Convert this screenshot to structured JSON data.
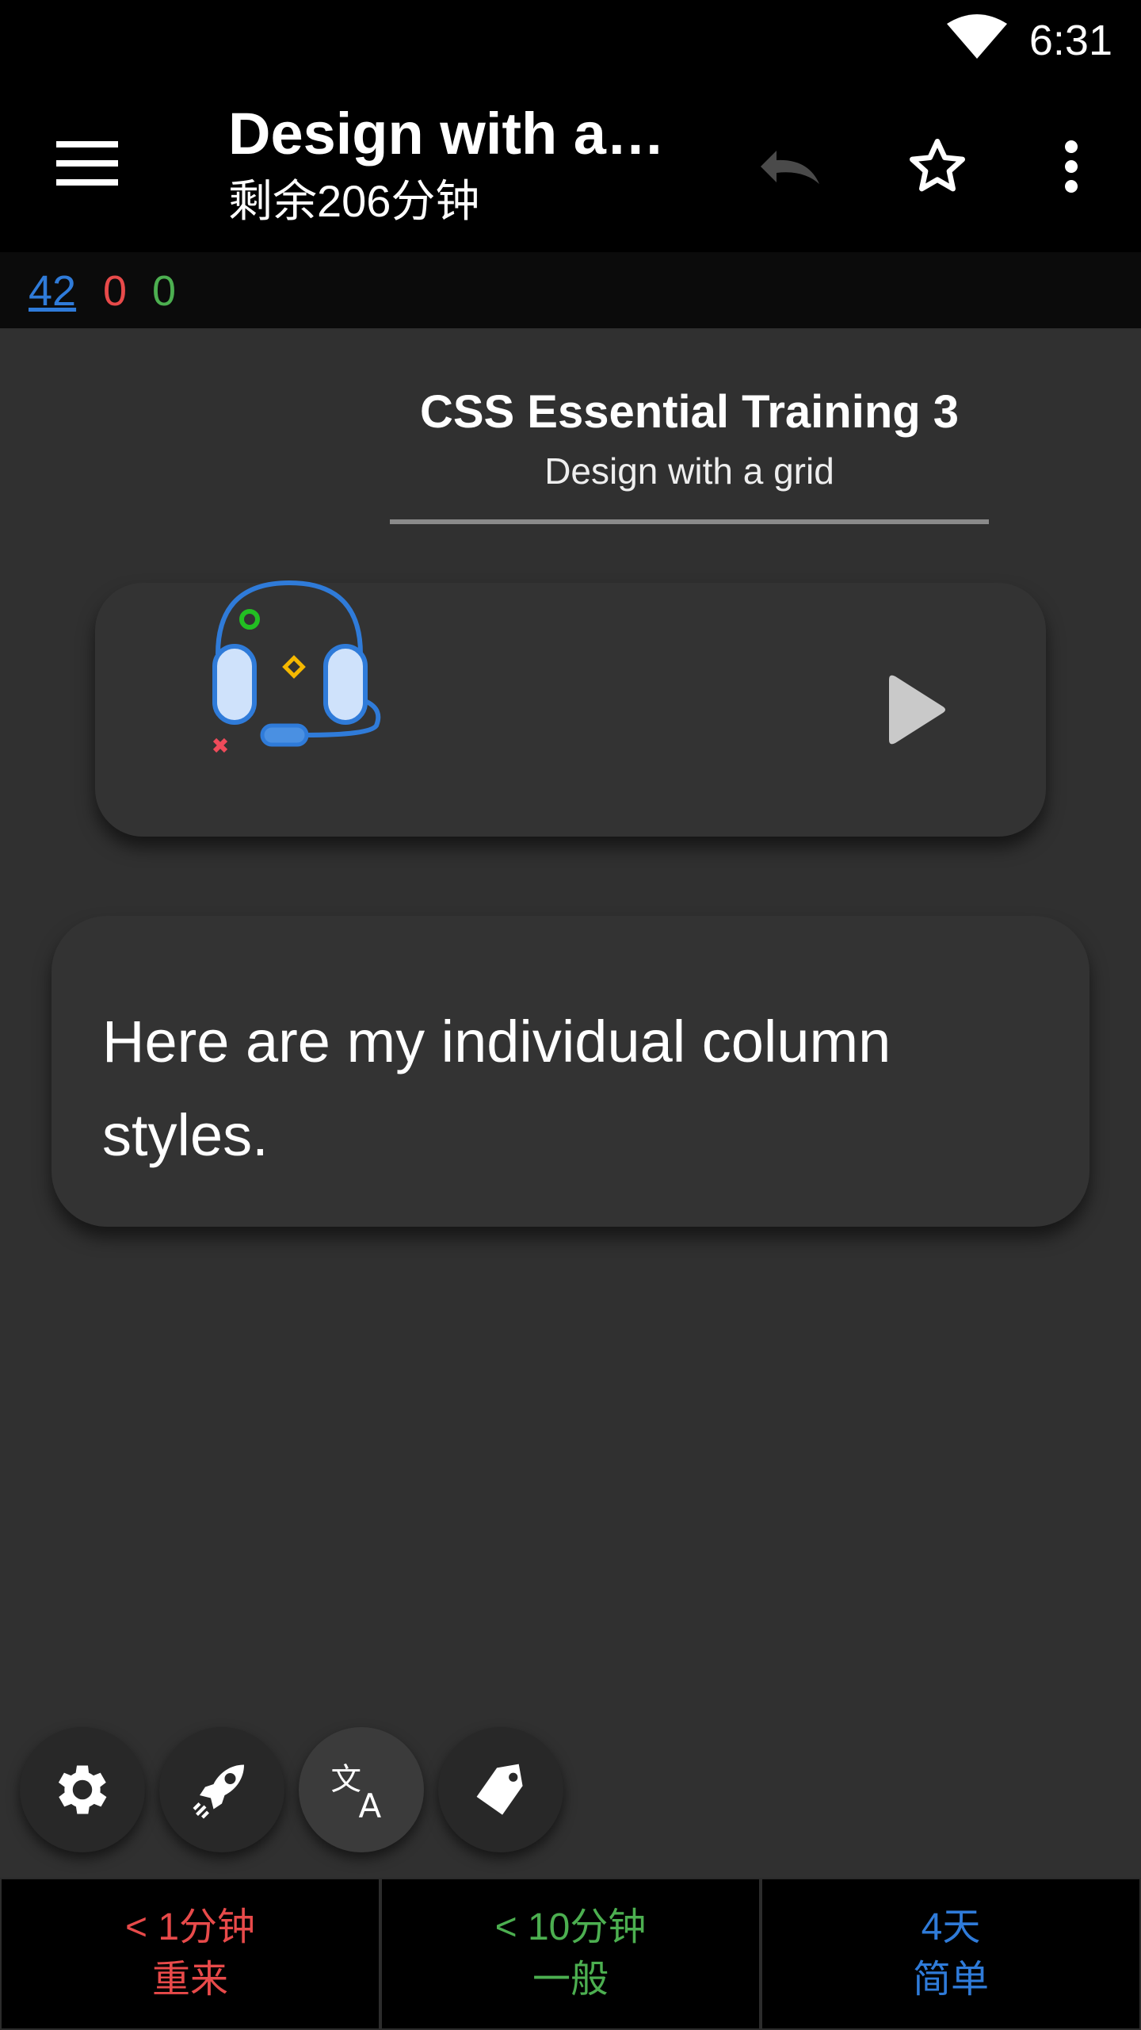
{
  "status_bar": {
    "time": "6:31",
    "wifi_icon": "wifi-icon"
  },
  "toolbar": {
    "title": "Design with a grid",
    "subtitle": "剩余206分钟",
    "icons": [
      "menu-icon",
      "undo-icon",
      "star-icon",
      "more-vert-icon"
    ]
  },
  "counts": {
    "new": "42",
    "learning": "0",
    "review": "0"
  },
  "deck": {
    "title": "CSS Essential Training 3",
    "subtitle": "Design with a grid"
  },
  "card": {
    "text": "Here are my individual column styles."
  },
  "fabs": [
    "settings-icon",
    "rocket-icon",
    "translate-icon",
    "tag-icon"
  ],
  "answers": [
    {
      "interval": "< 1分钟",
      "label": "重来",
      "color": "#e84a4a"
    },
    {
      "interval": "< 10分钟",
      "label": "一般",
      "color": "#4caf50"
    },
    {
      "interval": "4天",
      "label": "简单",
      "color": "#2f7bd9"
    }
  ],
  "colors": {
    "background": "#303030",
    "bar": "#000000",
    "accent_blue": "#2f7bd9",
    "red": "#e84a4a",
    "green": "#4caf50"
  }
}
